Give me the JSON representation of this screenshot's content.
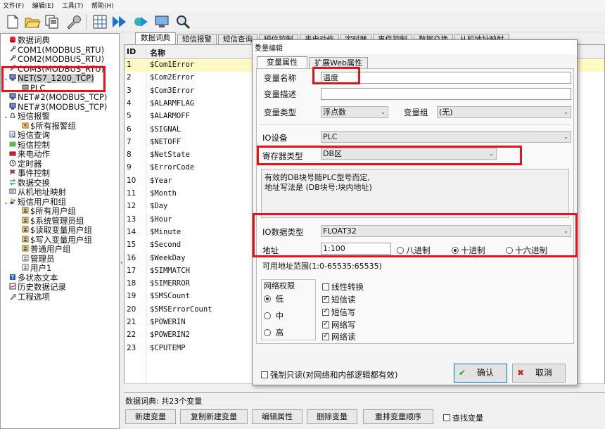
{
  "menubar": [
    "文件(F)",
    "编辑(E)",
    "工具(T)",
    "帮助(H)"
  ],
  "toolbar_icons": [
    "new-icon",
    "open-folder-icon",
    "copy-icon",
    "wrench-icon",
    "grid-icon",
    "run-icon",
    "step-icon",
    "monitor-icon",
    "search-icon"
  ],
  "tree": {
    "items": [
      {
        "label": "数据词典",
        "icon": "database-icon",
        "level": 0
      },
      {
        "label": "COM1(MODBUS_RTU)",
        "icon": "port-icon",
        "level": 0
      },
      {
        "label": "COM2(MODBUS_RTU)",
        "icon": "port-icon",
        "level": 0
      },
      {
        "label": "COM3(MODBUS_RTU)",
        "icon": "port-icon",
        "level": 0
      },
      {
        "label": "NET(S7_1200_TCP)",
        "icon": "network-icon",
        "level": 0,
        "expander": "⌄"
      },
      {
        "label": "PLC",
        "icon": "plc-icon",
        "level": 1
      },
      {
        "label": "NET#2(MODBUS_TCP)",
        "icon": "network-icon",
        "level": 0
      },
      {
        "label": "NET#3(MODBUS_TCP)",
        "icon": "network-icon",
        "level": 0
      },
      {
        "label": "短信报警",
        "icon": "bell-icon",
        "level": 0,
        "expander": "⌄"
      },
      {
        "label": "$所有报警组",
        "icon": "alarm-group-icon",
        "level": 1
      },
      {
        "label": "短信查询",
        "icon": "sms-query-icon",
        "level": 0
      },
      {
        "label": "短信控制",
        "icon": "sms-control-icon",
        "level": 0
      },
      {
        "label": "来电动作",
        "icon": "phone-icon",
        "level": 0
      },
      {
        "label": "定时器",
        "icon": "clock-icon",
        "level": 0
      },
      {
        "label": "事件控制",
        "icon": "event-icon",
        "level": 0
      },
      {
        "label": "数据交换",
        "icon": "exchange-icon",
        "level": 0
      },
      {
        "label": "从机地址映射",
        "icon": "map-icon",
        "level": 0
      },
      {
        "label": "短信用户和组",
        "icon": "users-icon",
        "level": 0,
        "expander": "⌄"
      },
      {
        "label": "$所有用户组",
        "icon": "user-group-icon",
        "level": 1
      },
      {
        "label": "$系统管理员组",
        "icon": "user-group-icon",
        "level": 1
      },
      {
        "label": "$读取变量用户组",
        "icon": "user-group-icon",
        "level": 1
      },
      {
        "label": "$写入变量用户组",
        "icon": "user-group-icon",
        "level": 1
      },
      {
        "label": "普通用户组",
        "icon": "user-group-icon",
        "level": 1
      },
      {
        "label": "管理员",
        "icon": "user-icon",
        "level": 1
      },
      {
        "label": "用户1",
        "icon": "user-icon",
        "level": 1
      },
      {
        "label": "多状态文本",
        "icon": "text-icon",
        "level": 0
      },
      {
        "label": "历史数据记录",
        "icon": "history-icon",
        "level": 0
      },
      {
        "label": "工程选项",
        "icon": "wrench-icon",
        "level": 0
      }
    ]
  },
  "tabs": [
    "数据词典",
    "短信报警",
    "短信查询",
    "短信控制",
    "来电动作",
    "定时器",
    "事件控制",
    "数据交换",
    "从机地址映射"
  ],
  "grid": {
    "headers": {
      "id": "ID",
      "name": "名称"
    },
    "rows": [
      {
        "id": "1",
        "name": "$Com1Error"
      },
      {
        "id": "2",
        "name": "$Com2Error"
      },
      {
        "id": "3",
        "name": "$Com3Error"
      },
      {
        "id": "4",
        "name": "$ALARMFLAG"
      },
      {
        "id": "5",
        "name": "$ALARMOFF"
      },
      {
        "id": "6",
        "name": "$SIGNAL"
      },
      {
        "id": "7",
        "name": "$NETOFF"
      },
      {
        "id": "8",
        "name": "$NetState"
      },
      {
        "id": "9",
        "name": "$ErrorCode"
      },
      {
        "id": "10",
        "name": "$Year"
      },
      {
        "id": "11",
        "name": "$Month"
      },
      {
        "id": "12",
        "name": "$Day"
      },
      {
        "id": "13",
        "name": "$Hour"
      },
      {
        "id": "14",
        "name": "$Minute"
      },
      {
        "id": "15",
        "name": "$Second"
      },
      {
        "id": "16",
        "name": "$WeekDay"
      },
      {
        "id": "17",
        "name": "$SIMMATCH"
      },
      {
        "id": "18",
        "name": "$SIMERROR"
      },
      {
        "id": "19",
        "name": "$SMSCount"
      },
      {
        "id": "20",
        "name": "$SMSErrorCount"
      },
      {
        "id": "21",
        "name": "$POWERIN"
      },
      {
        "id": "22",
        "name": "$POWERIN2"
      },
      {
        "id": "23",
        "name": "$CPUTEMP"
      }
    ]
  },
  "status": "数据词典: 共23个变量",
  "buttons": {
    "new": "新建变量",
    "copy_new": "复制新建变量",
    "edit": "编辑属性",
    "delete": "删除变量",
    "reorder": "重排变量顺序",
    "find": "查找变量"
  },
  "dialog": {
    "title": "变量编辑",
    "close": "×",
    "tabs": [
      "变量属性",
      "扩展Web属性"
    ],
    "var_name_label": "变量名称",
    "var_name_value": "温度",
    "var_desc_label": "变量描述",
    "var_desc_value": "",
    "var_type_label": "变量类型",
    "var_type_value": "浮点数",
    "var_group_label": "变量组",
    "var_group_value": "(无)",
    "io_device_label": "IO设备",
    "io_device_value": "PLC",
    "register_type_label": "寄存器类型",
    "register_type_value": "DB区",
    "desc_line1": "有效的DB块号随PLC型号而定,",
    "desc_line2": "地址写法是 (DB块号:块内地址)",
    "io_data_type_label": "IO数据类型",
    "io_data_type_value": "FLOAT32",
    "address_label": "地址",
    "address_value": "1:100",
    "radix": {
      "oct": "八进制",
      "dec": "十进制",
      "hex": "十六进制",
      "selected": "dec"
    },
    "addr_range": "可用地址范围(1:0-65535:65535)",
    "perm": {
      "title": "网络权限",
      "low": "低",
      "mid": "中",
      "high": "高",
      "selected": "low"
    },
    "checks": [
      {
        "label": "线性转换",
        "checked": false
      },
      {
        "label": "短信读",
        "checked": true
      },
      {
        "label": "短信写",
        "checked": true
      },
      {
        "label": "网络写",
        "checked": true
      },
      {
        "label": "网络读",
        "checked": true
      }
    ],
    "force_readonly": "强制只读(对网络和内部逻辑都有效)",
    "ok": "确认",
    "cancel": "取消"
  },
  "colors": {
    "highlight": "#e3141c",
    "selected_row": "#fff9c4",
    "ok_icon": "#2e9e2e",
    "cancel_icon": "#d22020"
  }
}
